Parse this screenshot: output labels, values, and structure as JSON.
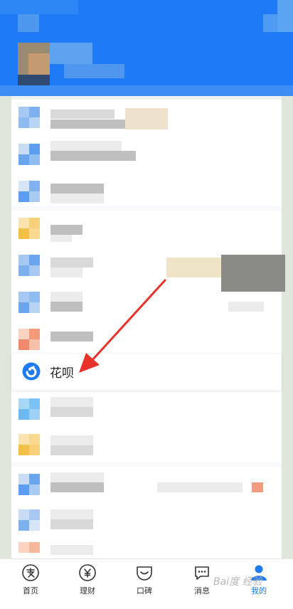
{
  "focus_item": {
    "label": "花呗",
    "icon": "huabei-icon"
  },
  "tabbar": {
    "tabs": [
      {
        "id": "home",
        "label": "首页",
        "icon": "alipay-home-icon",
        "active": false
      },
      {
        "id": "wealth",
        "label": "理财",
        "icon": "yen-icon",
        "active": false
      },
      {
        "id": "koubei",
        "label": "口碑",
        "icon": "koubei-icon",
        "active": false
      },
      {
        "id": "messages",
        "label": "消息",
        "icon": "chat-bubble-icon",
        "active": false
      },
      {
        "id": "mine",
        "label": "我的",
        "icon": "user-icon",
        "active": true
      }
    ]
  },
  "watermark": {
    "text": "Bai度 经验"
  },
  "colors": {
    "primary": "#1f7bf5",
    "header_bg": "#1f7bf5",
    "arrow": "#e8322a"
  }
}
